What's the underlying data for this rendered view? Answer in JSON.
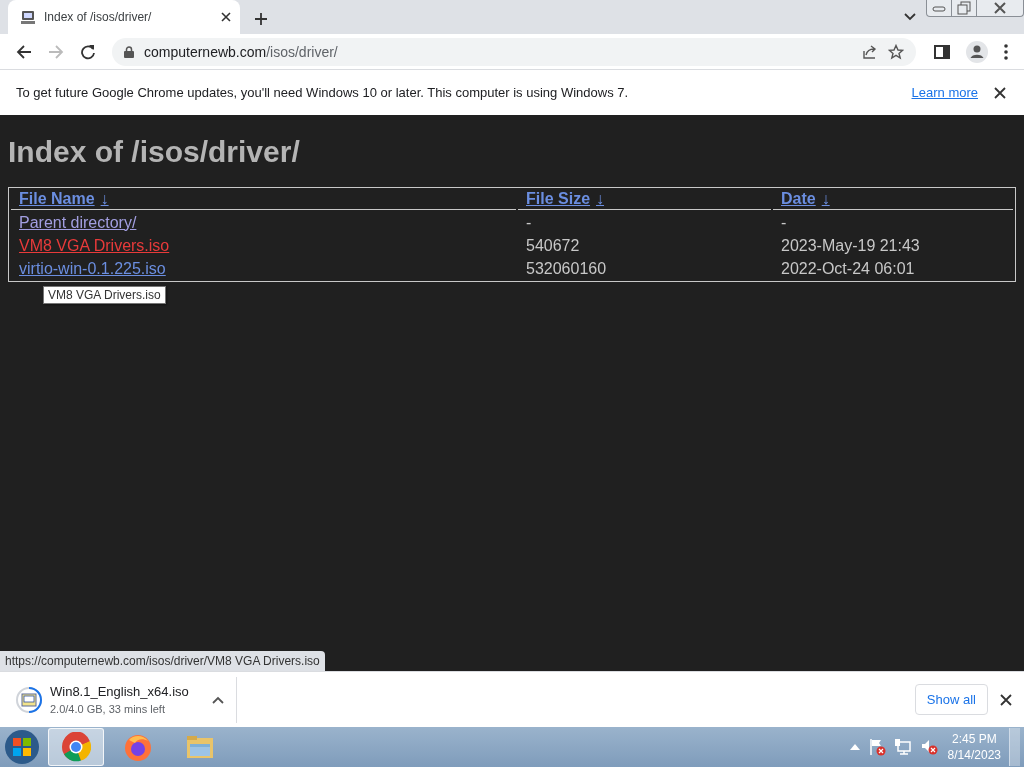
{
  "tab": {
    "title": "Index of /isos/driver/"
  },
  "address_bar": {
    "url_host": "computernewb.com",
    "url_path": "/isos/driver/"
  },
  "info_bar": {
    "message": "To get future Google Chrome updates, you'll need Windows 10 or later. This computer is using Windows 7.",
    "link": "Learn more"
  },
  "page": {
    "heading": "Index of /isos/driver/",
    "columns": [
      {
        "label": "File Name",
        "sort_arrow": "↓"
      },
      {
        "label": "File Size",
        "sort_arrow": "↓"
      },
      {
        "label": "Date",
        "sort_arrow": "↓"
      }
    ],
    "rows": [
      {
        "name": "Parent directory/",
        "size": "-",
        "date": "-",
        "visited": true,
        "hovered": false
      },
      {
        "name": "VM8 VGA Drivers.iso",
        "size": "540672",
        "date": "2023-May-19 21:43",
        "hovered": true
      },
      {
        "name": "virtio-win-0.1.225.iso",
        "size": "532060160",
        "date": "2022-Oct-24 06:01",
        "visited": false,
        "hovered": false
      }
    ]
  },
  "tooltip": "VM8 VGA Drivers.iso",
  "status_url": "https://computernewb.com/isos/driver/VM8 VGA Drivers.iso",
  "download": {
    "file": "Win8.1_English_x64.iso",
    "progress_text": "2.0/4.0 GB, 33 mins left",
    "show_all": "Show all"
  },
  "taskbar": {
    "apps": [
      {
        "kind": "chrome",
        "active": true
      },
      {
        "kind": "firefox",
        "active": false
      },
      {
        "kind": "explorer",
        "active": false
      }
    ],
    "time": "2:45 PM",
    "date": "8/14/2023"
  }
}
